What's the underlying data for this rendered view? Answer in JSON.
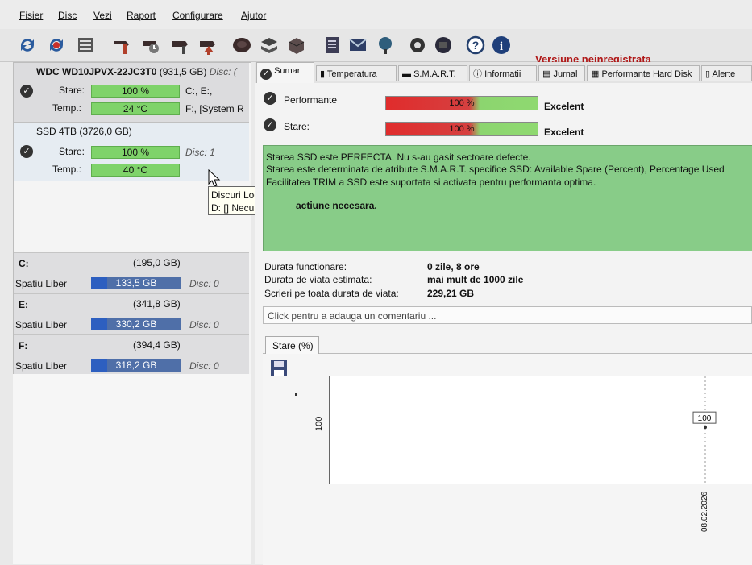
{
  "menu": [
    "Fisier",
    "Disc",
    "Vezi",
    "Raport",
    "Configurare",
    "Ajutor"
  ],
  "toolbar": {
    "icons": [
      "refresh-icon",
      "refresh-all-icon",
      "list-icon",
      "disk-hammer-icon",
      "disk-clock-icon",
      "disk-tool-icon",
      "disk-arrow-icon",
      "disk-icon",
      "disks-stack-icon",
      "cube-icon",
      "document-icon",
      "email-icon",
      "network-icon",
      "gear-icon",
      "chip-icon",
      "help-icon",
      "info-icon"
    ],
    "unregistered": "Versiune neinregistrata"
  },
  "disks": [
    {
      "title": "WDC WD10JPVX-22JC3T0",
      "size": "(931,5 GB)",
      "disc_label": "Disc: (",
      "stare_label": "Stare:",
      "stare_value": "100 %",
      "temp_label": "Temp.:",
      "temp_value": "24 °C",
      "drives": "C:, E:,",
      "drives2": "F:, [System R"
    },
    {
      "title": "SSD 4TB",
      "size": "(3726,0 GB)",
      "stare_label": "Stare:",
      "stare_value": "100 %",
      "temp_label": "Temp.:",
      "temp_value": "40 °C",
      "disc_label": "Disc: 1"
    }
  ],
  "partitions": [
    {
      "letter": "C:",
      "size": "(195,0 GB)",
      "free_label": "Spatiu Liber",
      "free": "133,5 GB",
      "disc": "Disc: 0"
    },
    {
      "letter": "E:",
      "size": "(341,8 GB)",
      "free_label": "Spatiu Liber",
      "free": "330,2 GB",
      "disc": "Disc: 0"
    },
    {
      "letter": "F:",
      "size": "(394,4 GB)",
      "free_label": "Spatiu Liber",
      "free": "318,2 GB",
      "disc": "Disc: 0"
    }
  ],
  "tooltip": {
    "line1": "Discuri Logice",
    "line2": "D: [] Necunoscut"
  },
  "tabs": [
    "Sumar",
    "Temperatura",
    "S.M.A.R.T.",
    "Informatii",
    "Jurnal",
    "Performante Hard Disk",
    "Alerte"
  ],
  "summary": {
    "perf_label": "Performante",
    "perf_value": "100 %",
    "perf_rating": "Excelent",
    "stare_label": "Stare:",
    "stare_value": "100 %",
    "stare_rating": "Excelent",
    "message": [
      "Starea SSD este PERFECTA. Nu s-au gasit sectoare defecte.",
      "Starea este determinata de atribute S.M.A.R.T. specifice SSD: Available Spare (Percent), Percentage Used",
      "Facilitatea TRIM a SSD este suportata si activata pentru performanta optima.",
      "actiune necesara."
    ],
    "stats": [
      {
        "label": "Durata functionare:",
        "value": "0 zile, 8 ore"
      },
      {
        "label": "Durata de viata estimata:",
        "value": "mai mult de 1000 zile"
      },
      {
        "label": "Scrieri pe toata durata de viata:",
        "value": "229,21 GB"
      }
    ],
    "comment_placeholder": "Click pentru a adauga un comentariu ..."
  },
  "chart_data": {
    "type": "line",
    "tab_label": "Stare (%)",
    "ylabel": "100",
    "x": [
      "08.02.2026"
    ],
    "series": [
      {
        "values": [
          100
        ]
      }
    ],
    "point_label": "100"
  }
}
